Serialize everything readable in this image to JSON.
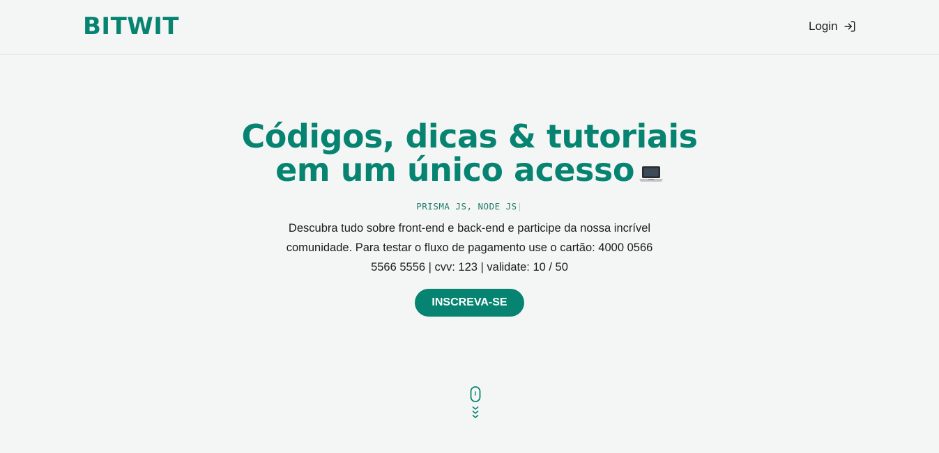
{
  "header": {
    "logo": "BITWIT",
    "login_label": "Login"
  },
  "hero": {
    "title": "Códigos, dicas & tutoriais em um único acesso",
    "typed_text": "PRISMA JS, NODE JS",
    "description": "Descubra tudo sobre front-end e back-end e participe da nossa incrível comunidade. Para testar o fluxo de pagamento use o cartão: 4000 0566 5566 5556 | cvv: 123 | validate: 10 / 50",
    "cta_label": "INSCREVA-SE"
  },
  "icons": {
    "login": "login-arrow-icon",
    "laptop": "laptop-icon",
    "scroll": "mouse-scroll-icon"
  },
  "colors": {
    "brand": "#068471",
    "background": "#f4f6f5"
  }
}
